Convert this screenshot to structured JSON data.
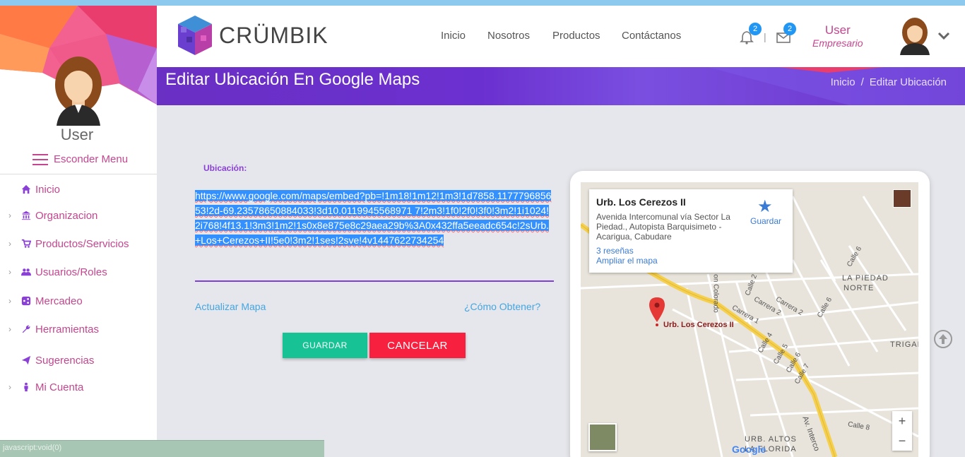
{
  "status_bar": "javascript:void(0)",
  "sidebar": {
    "user_name": "User",
    "toggle_label": "Esconder Menu",
    "items": [
      {
        "label": "Inicio",
        "icon": "home-icon",
        "chevron": false
      },
      {
        "label": "Organizacion",
        "icon": "bank-icon",
        "chevron": true
      },
      {
        "label": "Productos/Servicios",
        "icon": "cart-icon",
        "chevron": true
      },
      {
        "label": "Usuarios/Roles",
        "icon": "users-icon",
        "chevron": true
      },
      {
        "label": "Mercadeo",
        "icon": "share-icon",
        "chevron": true
      },
      {
        "label": "Herramientas",
        "icon": "wrench-icon",
        "chevron": true
      },
      {
        "label": "Sugerencias",
        "icon": "paper-plane-icon",
        "chevron": false
      },
      {
        "label": "Mi Cuenta",
        "icon": "person-icon",
        "chevron": true
      }
    ]
  },
  "header": {
    "brand": "CRÜMBIK",
    "menu": [
      "Inicio",
      "Nosotros",
      "Productos",
      "Contáctanos"
    ],
    "notifications_count": "2",
    "messages_count": "2",
    "separator": "|",
    "user_name": "User",
    "user_role": "Empresario"
  },
  "banner": {
    "title": "Editar Ubicación En Google Maps",
    "breadcrumb": [
      "Inicio",
      "Editar Ubicación"
    ],
    "breadcrumb_sep": "/"
  },
  "form": {
    "label": "Ubicación:",
    "url_value": "https://www.google.com/maps/embed?pb=!1m18!1m12!1m3!1d7858.117779685653!2d-69.23578650884033!3d10.0119945568971 7!2m3!1f0!2f0!3f0!3m2!1i1024!2i768!4f13.1!3m3!1m2!1s0x8e875e8c29aea29b%3A0x432ffa5eeadc654c!2sUrb.+Los+Cerezos+II!5e0!3m2!1ses!2sve!4v1447622734254",
    "update_link": "Actualizar Mapa",
    "how_link": "¿Cómo Obtener?",
    "save_label": "GUARDAR",
    "cancel_label": "CANCELAR"
  },
  "map": {
    "place_name": "Urb. Los Cerezos II",
    "address": "Avenida Intercomunal vía Sector La Piedad., Autopista Barquisimeto - Acarigua, Cabudare",
    "reviews": "3 reseñas",
    "expand": "Ampliar el mapa",
    "save": "Guardar",
    "pin_label": "Urb. Los Cerezos II",
    "zoom_in": "+",
    "zoom_out": "−",
    "google": "Google",
    "roads": [
      "LA PIEDAD",
      "NORTE",
      "Carrera 2",
      "Carrera 2",
      "Carrera 1",
      "Calle 2",
      "Calle 6",
      "Calle 6",
      "Calle 4",
      "Calle 5",
      "Calle 6",
      "Calle 7",
      "Calle 8",
      "TRIGAL",
      "Av. Interco",
      "URB. ALTOS",
      "LA FLORIDA",
      "on Colorado",
      "4"
    ],
    "colors": {
      "road_yellow": "#f5d04e",
      "pin_red": "#e53935"
    }
  },
  "colors": {
    "accent": "#c4468f",
    "banner": "#6a2fc3",
    "save": "#17c394",
    "cancel": "#f8203f",
    "link": "#44a6e0"
  }
}
